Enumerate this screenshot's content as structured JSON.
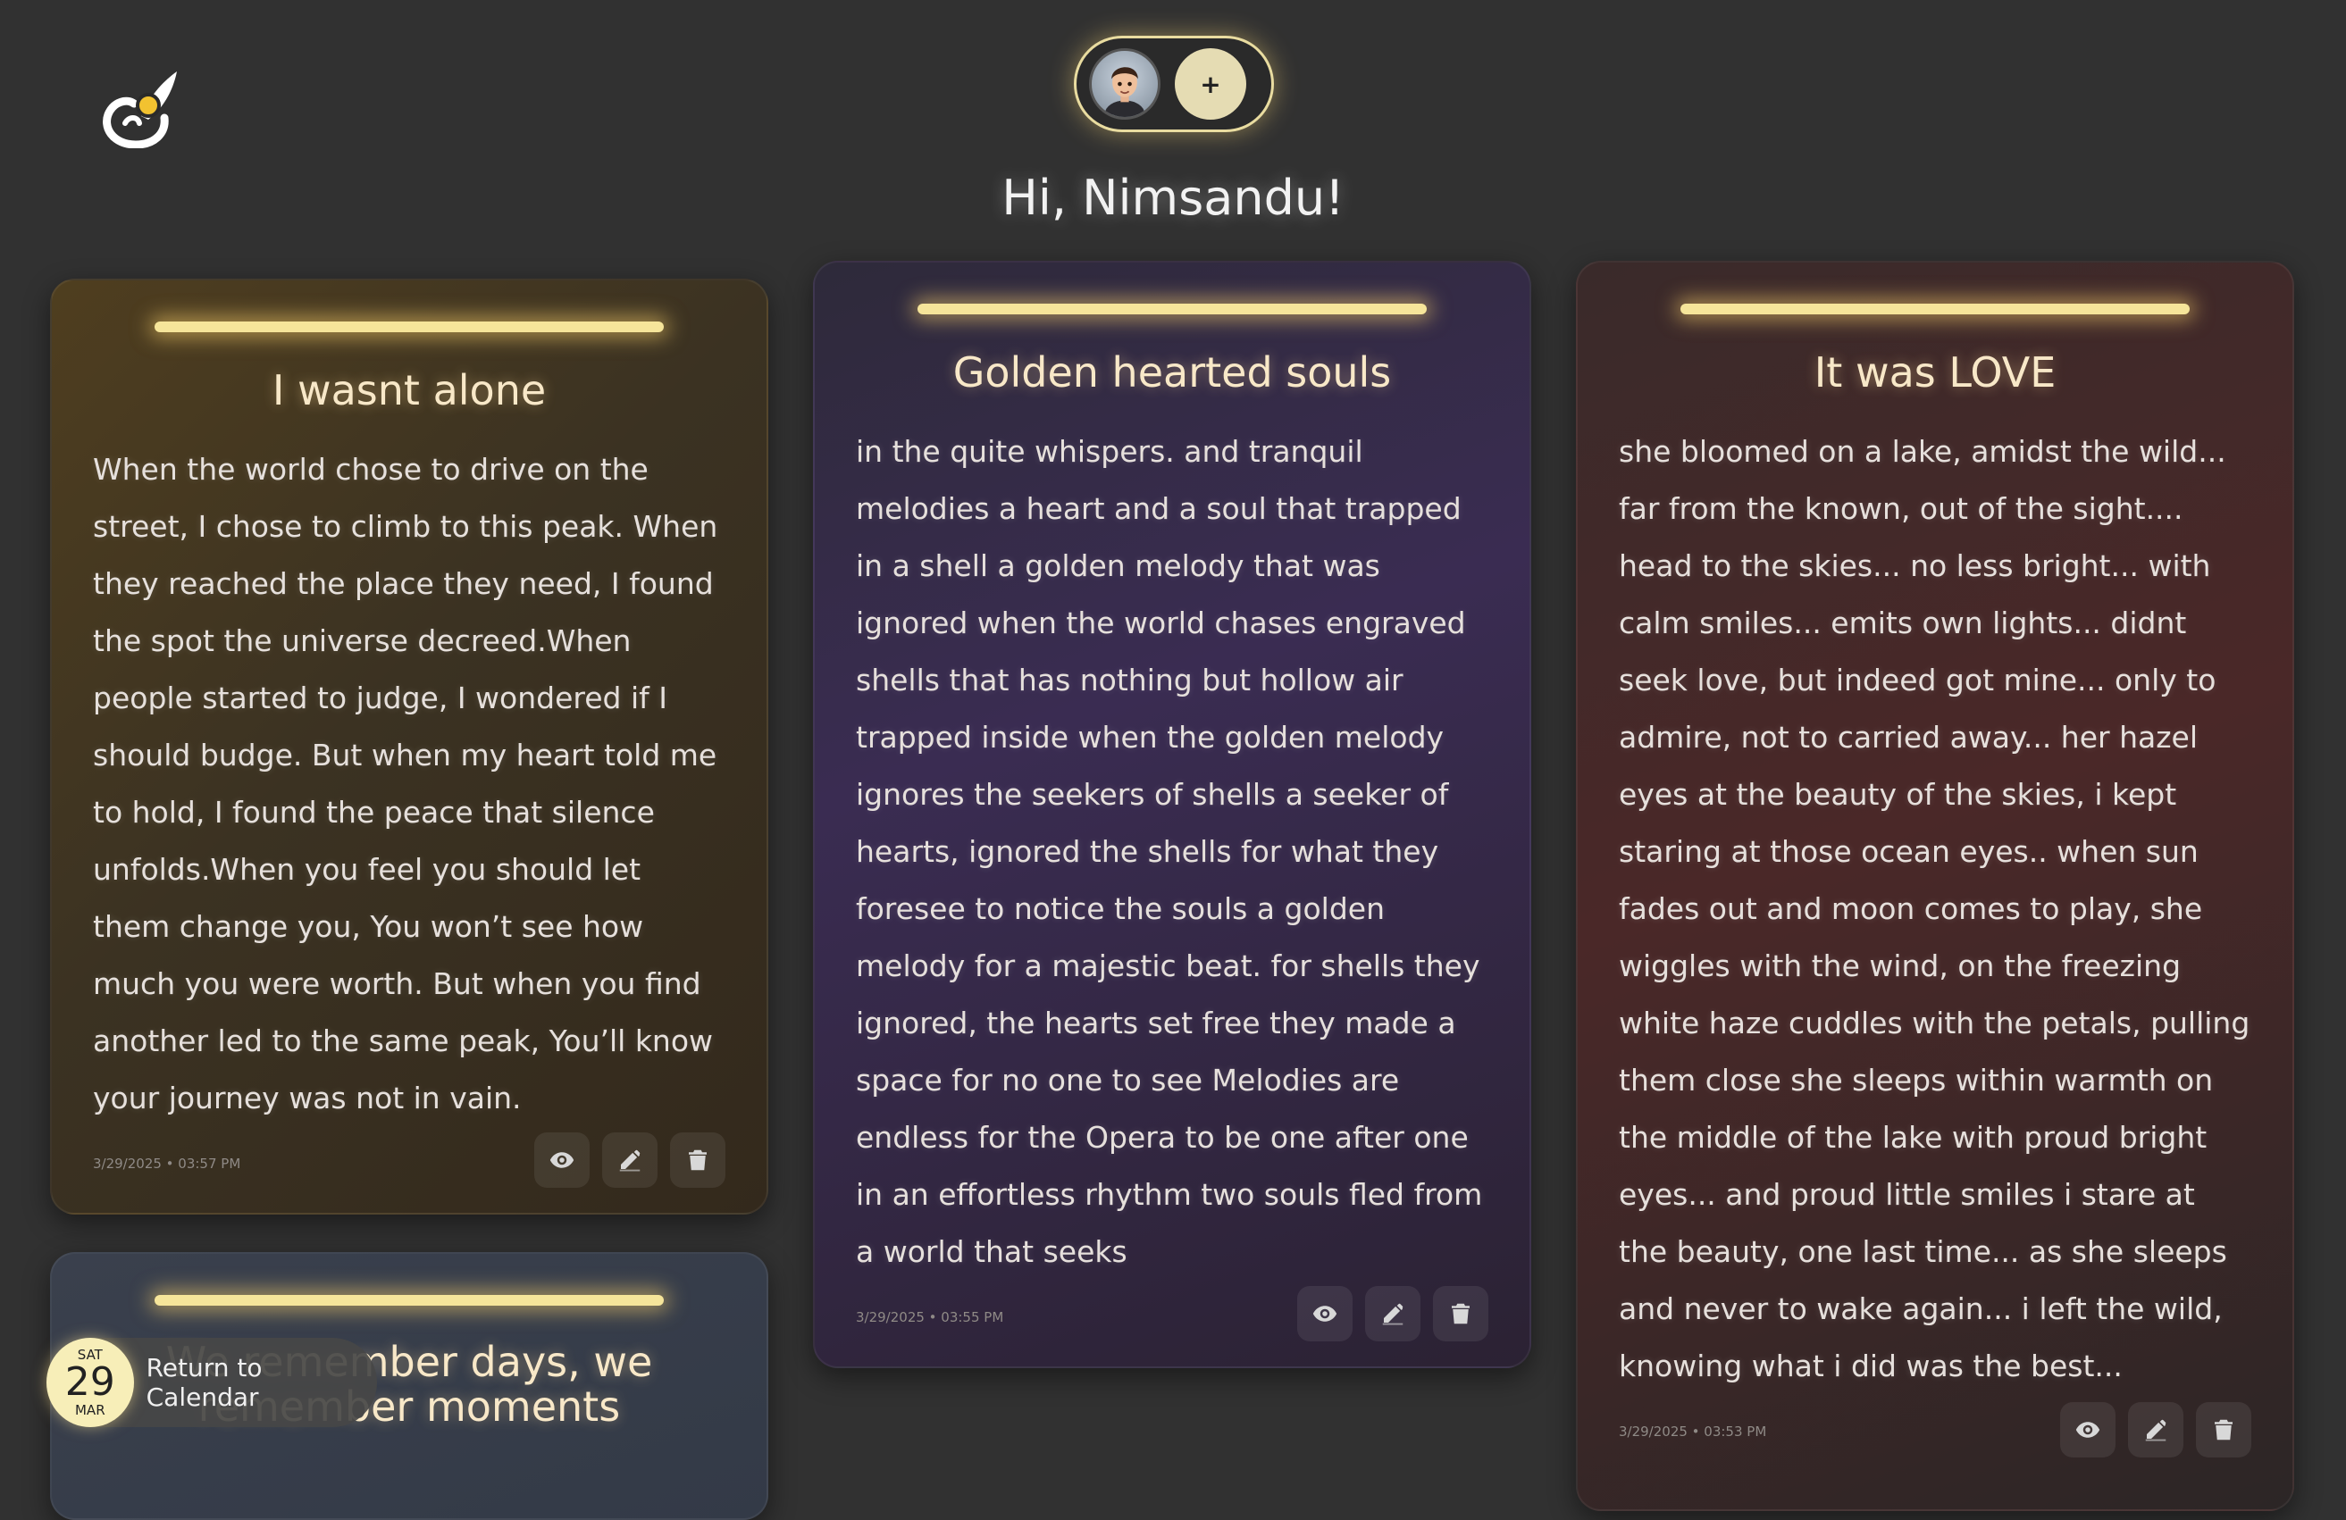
{
  "header": {
    "greeting": "Hi, Nimsandu!",
    "add_account_label": "+"
  },
  "cards": [
    {
      "title": "I wasnt alone",
      "body": "When the world chose to drive on the street, I chose to climb to this peak. When they reached the place they need, I found the spot the universe decreed.When people started to judge, I wondered if I should budge. But when my heart told me to hold, I found the peace that silence unfolds.When you feel you should let them change you, You won’t see how much you were worth. But when you find another led to the same peak, You’ll know your journey was not in vain.",
      "date": "3/29/2025 • 03:57 PM",
      "accent": "#4f3e1f"
    },
    {
      "title": "Golden hearted souls",
      "body": "in the quite whispers. and tranquil melodies a heart and a soul that trapped in a shell a golden melody that was ignored when the world chases engraved shells that has nothing but hollow air trapped inside when the golden melody ignores the seekers of shells a seeker of hearts, ignored the shells for what they foresee to notice the souls a golden melody for a majestic beat. for shells they ignored, the hearts set free they made a space for no one to see Melodies are endless for the Opera to be one after one in an effortless rhythm two souls fled from a world that seeks",
      "date": "3/29/2025 • 03:55 PM",
      "accent": "#3a2c52"
    },
    {
      "title": "It was LOVE",
      "body": "she bloomed on a lake, amidst the wild... far from the known, out of the sight.... head to the skies... no less bright... with calm smiles... emits own lights... didnt seek love, but indeed got mine... only to admire, not to carried away... her hazel eyes at the beauty of the skies,  i kept staring at those ocean eyes.. when sun fades out and moon comes to play, she wiggles with the wind, on the freezing white haze cuddles with the petals, pulling them close she sleeps within warmth on the middle of the lake with proud bright eyes... and proud little smiles i stare at the beauty, one last time... as she sleeps and never to wake again... i left the wild, knowing what i did was the best...",
      "date": "3/29/2025 • 03:53 PM",
      "accent": "#4a2828"
    },
    {
      "title": "We remember days, we remember moments",
      "accent": "#333a47"
    }
  ],
  "calendar": {
    "day_of_week": "SAT",
    "day": "29",
    "month": "MAR",
    "label": "Return to Calendar"
  },
  "icons": [
    "app-logo-icon",
    "eye-icon",
    "edit-icon",
    "trash-icon"
  ]
}
